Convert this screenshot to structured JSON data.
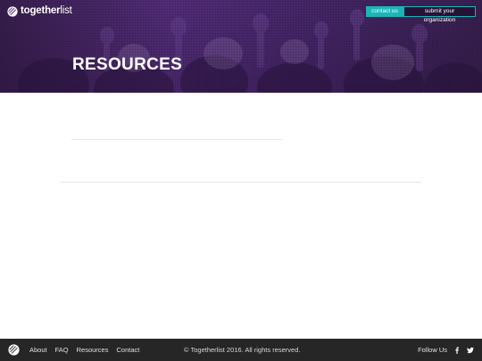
{
  "header": {
    "logo": {
      "bold": "together",
      "light": "list"
    },
    "contact_label": "contact us",
    "submit_label": "submit your organization"
  },
  "hero": {
    "title": "RESOURCES"
  },
  "footer": {
    "nav": [
      {
        "label": "About"
      },
      {
        "label": "FAQ"
      },
      {
        "label": "Resources"
      },
      {
        "label": "Contact"
      }
    ],
    "copyright": "© Togetherlist 2016. All rights reserved.",
    "follow_label": "Follow Us",
    "social": [
      {
        "icon": "facebook-icon"
      },
      {
        "icon": "twitter-icon"
      }
    ]
  },
  "colors": {
    "accent": "#1ab6b6",
    "hero_purple": "#5a3284",
    "footer_bg": "#262626"
  }
}
